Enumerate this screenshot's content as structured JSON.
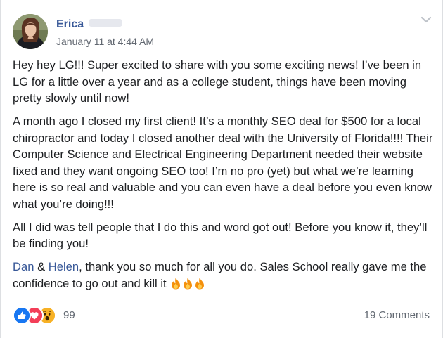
{
  "post": {
    "author_name": "Erica",
    "timestamp": "January 11 at 4:44 AM",
    "paragraphs": {
      "p1": "Hey hey LG!!! Super excited to share with you some exciting news! I’ve been in LG for a little over a year and as a college student, things have been moving pretty slowly until now!",
      "p2": "A month ago I closed my first client! It’s a monthly SEO deal for $500 for a local chiropractor and today I closed another deal with the University of Florida!!!! Their Computer Science and Electrical Engineering Department needed their website fixed and they want ongoing SEO too! I’m no pro (yet) but what we’re learning here is so real and valuable and you can even have a deal before you even know what you’re doing!!!",
      "p3": "All I did was tell people that I do this and word got out! Before you know it, they’ll be finding you!",
      "p4_mention_1": "Dan",
      "p4_and": " & ",
      "p4_mention_2": "Helen",
      "p4_text": ", thank you so much for all you do. Sales School really gave me the confidence to go out and kill it "
    },
    "emoji": [
      "fire-emoji",
      "fire-emoji",
      "fire-emoji"
    ],
    "reactions": {
      "types": [
        "like",
        "love",
        "wow"
      ],
      "count": "99"
    },
    "comments_label": "19 Comments",
    "icons": {
      "menu": "chevron-down-icon"
    },
    "colors": {
      "link": "#385898",
      "like": "#1877f2",
      "love": "#f33e58",
      "wow": "#f7b125",
      "meta": "#616770"
    }
  }
}
